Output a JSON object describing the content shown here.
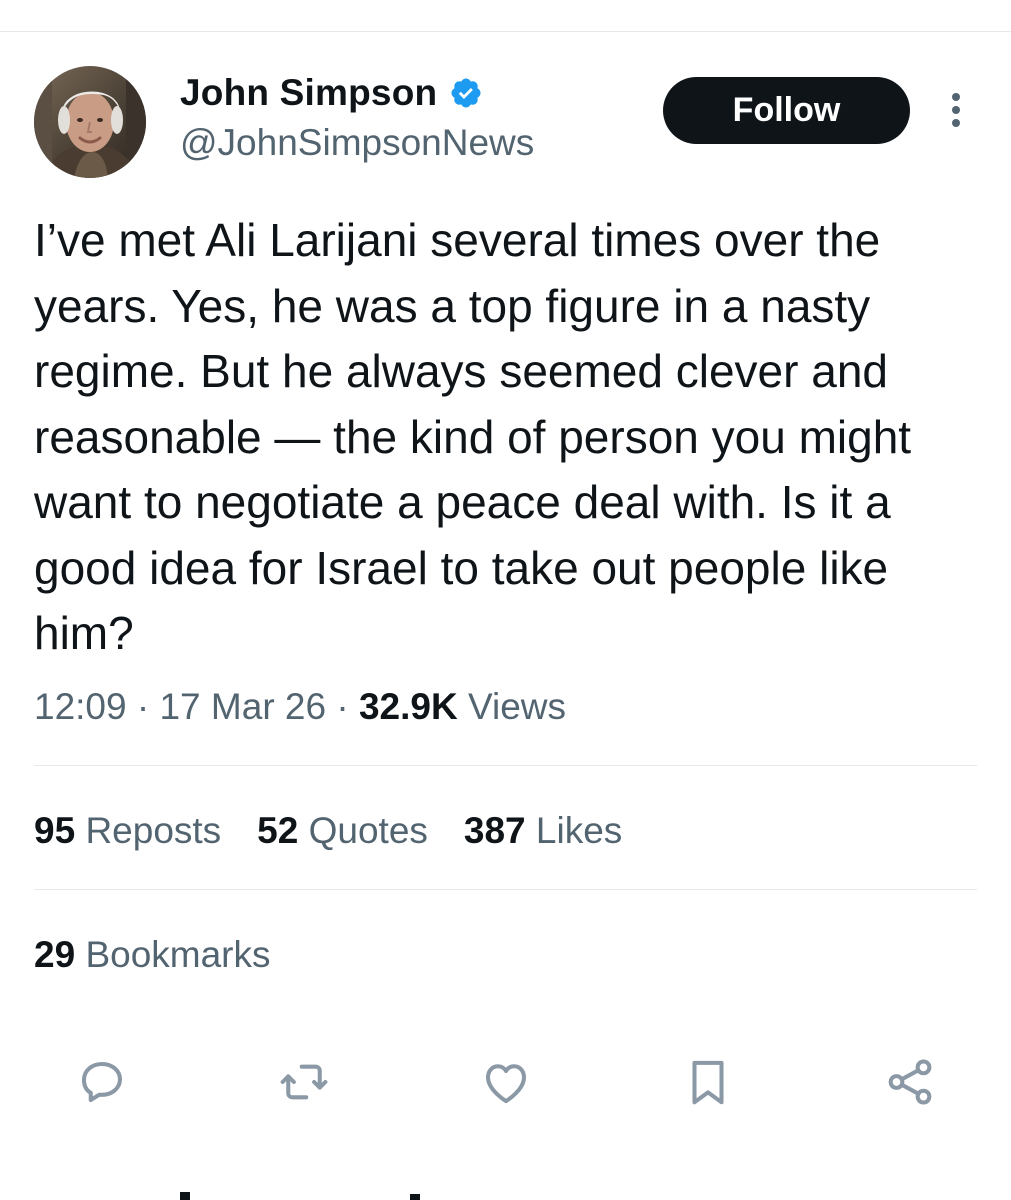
{
  "author": {
    "display_name": "John Simpson",
    "handle": "@JohnSimpsonNews",
    "verified": true,
    "avatar_icon": "profile-photo"
  },
  "follow_button": {
    "label": "Follow"
  },
  "more_menu_icon": "vertical-dots-icon",
  "tweet": {
    "text": "I’ve met Ali Larijani several times over the years. Yes, he was a top figure in a nasty regime. But he always seemed clever and reasonable — the kind of person you might want to negotiate a peace deal with. Is it a good idea for Israel to take out people like him?"
  },
  "meta": {
    "time": "12:09",
    "separator": "·",
    "date": "17 Mar 26",
    "views_count": "32.9K",
    "views_label": "Views"
  },
  "stats": {
    "reposts": {
      "count": "95",
      "label": "Reposts"
    },
    "quotes": {
      "count": "52",
      "label": "Quotes"
    },
    "likes": {
      "count": "387",
      "label": "Likes"
    },
    "bookmarks": {
      "count": "29",
      "label": "Bookmarks"
    }
  },
  "actions": [
    "reply-icon",
    "repost-icon",
    "like-icon",
    "bookmark-icon",
    "share-icon"
  ],
  "colors": {
    "primary_text": "#0f1419",
    "secondary_text": "#536471",
    "verified_badge": "#1d9bf0",
    "follow_button_bg": "#0f1419",
    "divider": "#e6e9ec"
  }
}
